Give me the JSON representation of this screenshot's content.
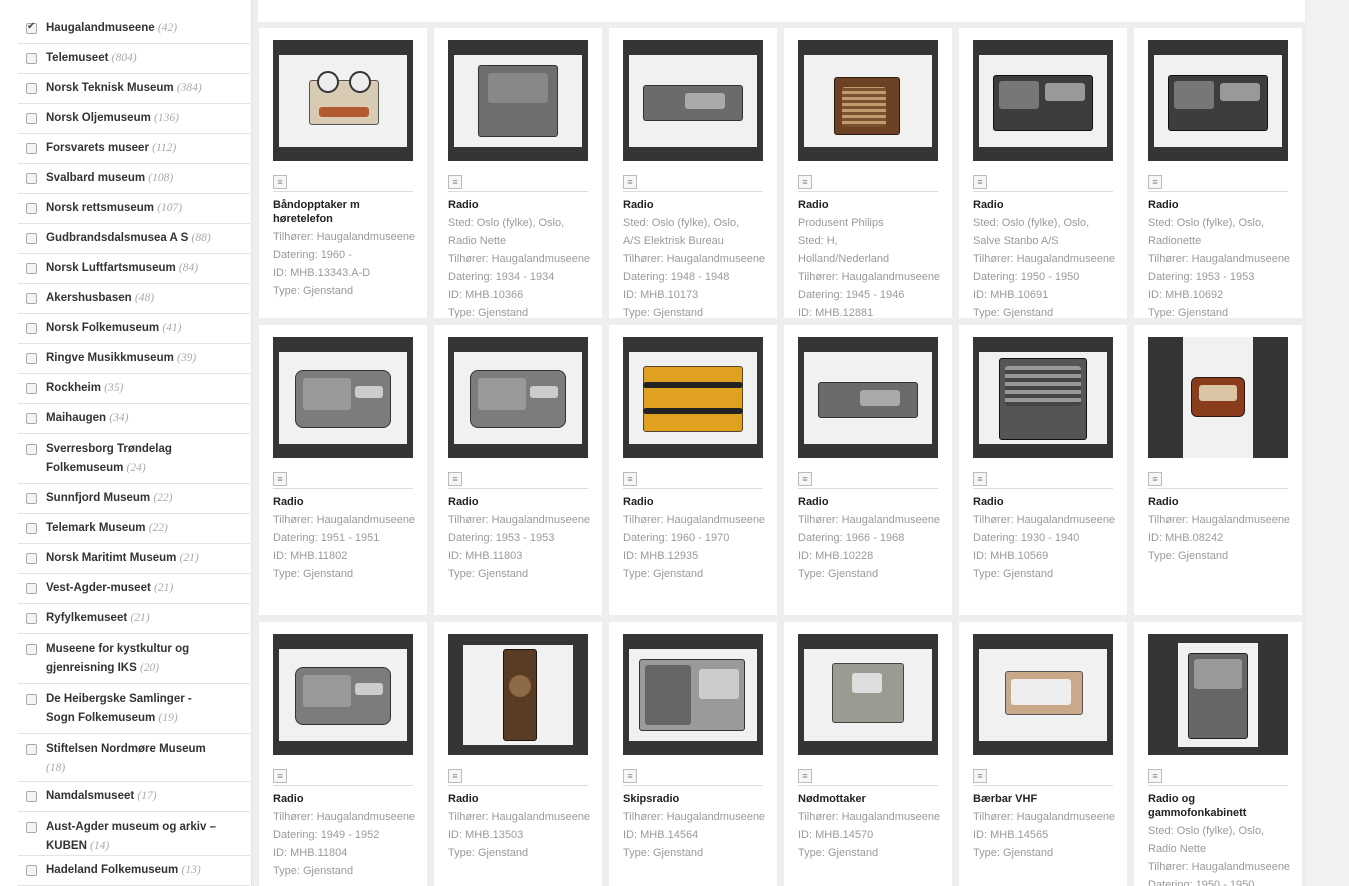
{
  "facets": [
    {
      "label": "Haugalandmuseene",
      "count": "(42)",
      "checked": true
    },
    {
      "label": "Telemuseet",
      "count": "(804)",
      "checked": false
    },
    {
      "label": "Norsk Teknisk Museum",
      "count": "(384)",
      "checked": false
    },
    {
      "label": "Norsk Oljemuseum",
      "count": "(136)",
      "checked": false
    },
    {
      "label": "Forsvarets museer",
      "count": "(112)",
      "checked": false
    },
    {
      "label": "Svalbard museum",
      "count": "(108)",
      "checked": false
    },
    {
      "label": "Norsk rettsmuseum",
      "count": "(107)",
      "checked": false
    },
    {
      "label": "Gudbrandsdalsmusea A S",
      "count": "(88)",
      "checked": false
    },
    {
      "label": "Norsk Luftfartsmuseum",
      "count": "(84)",
      "checked": false
    },
    {
      "label": "Akershusbasen",
      "count": "(48)",
      "checked": false
    },
    {
      "label": "Norsk Folkemuseum",
      "count": "(41)",
      "checked": false
    },
    {
      "label": "Ringve Musikkmuseum",
      "count": "(39)",
      "checked": false
    },
    {
      "label": "Rockheim",
      "count": "(35)",
      "checked": false
    },
    {
      "label": "Maihaugen",
      "count": "(34)",
      "checked": false
    },
    {
      "label": "Sverresborg Trøndelag Folkemuseum",
      "count": "(24)",
      "checked": false
    },
    {
      "label": "Sunnfjord Museum",
      "count": "(22)",
      "checked": false
    },
    {
      "label": "Telemark Museum",
      "count": "(22)",
      "checked": false
    },
    {
      "label": "Norsk Maritimt Museum",
      "count": "(21)",
      "checked": false
    },
    {
      "label": "Vest-Agder-museet",
      "count": "(21)",
      "checked": false
    },
    {
      "label": "Ryfylkemuseet",
      "count": "(21)",
      "checked": false
    },
    {
      "label": "Museene for kystkultur og gjenreisning IKS",
      "count": "(20)",
      "checked": false
    },
    {
      "label": "De Heibergske Samlinger - Sogn Folkemuseum",
      "count": "(19)",
      "checked": false
    },
    {
      "label": "Stiftelsen Nordmøre Museum",
      "count": "(18)",
      "checked": false
    },
    {
      "label": "Namdalsmuseet",
      "count": "(17)",
      "checked": false
    },
    {
      "label": "Aust-Agder museum og arkiv – KUBEN",
      "count": "(14)",
      "checked": false
    },
    {
      "label": "Hadeland Folkemuseum",
      "count": "(13)",
      "checked": false
    }
  ],
  "items": [
    {
      "title": "Båndopptaker m høretelefon",
      "meta": [
        "Tilhører: Haugalandmuseene",
        "Datering: 1960 -",
        "ID: MHB.13343.A-D",
        "Type: Gjenstand"
      ],
      "kind": "tape"
    },
    {
      "title": "Radio",
      "meta": [
        "Sted: Oslo (fylke), Oslo,",
        "Radio Nette",
        "Tilhører: Haugalandmuseene",
        "Datering: 1934 - 1934",
        "ID: MHB.10366",
        "Type: Gjenstand"
      ],
      "kind": "boxradio"
    },
    {
      "title": "Radio",
      "meta": [
        "Sted: Oslo (fylke), Oslo,",
        "A/S Elektrisk Bureau",
        "Tilhører: Haugalandmuseene",
        "Datering: 1948 - 1948",
        "ID: MHB.10173",
        "Type: Gjenstand"
      ],
      "kind": "flatradio"
    },
    {
      "title": "Radio",
      "meta": [
        "Produsent Philips",
        "Sted: H,",
        "Holland/Nederland",
        "Tilhører: Haugalandmuseene",
        "Datering: 1945 - 1946",
        "ID: MHB.12881"
      ],
      "kind": "brownradio"
    },
    {
      "title": "Radio",
      "meta": [
        "Sted: Oslo (fylke), Oslo,",
        "Salve Stanbo A/S",
        "Tilhører: Haugalandmuseene",
        "Datering: 1950 - 1950",
        "ID: MHB.10691",
        "Type: Gjenstand"
      ],
      "kind": "darkradio"
    },
    {
      "title": "Radio",
      "meta": [
        "Sted: Oslo (fylke), Oslo,",
        "Radionette",
        "Tilhører: Haugalandmuseene",
        "Datering: 1953 - 1953",
        "ID: MHB.10692",
        "Type: Gjenstand"
      ],
      "kind": "darkradio"
    },
    {
      "title": "Radio",
      "meta": [
        "Tilhører: Haugalandmuseene",
        "Datering: 1951 - 1951",
        "ID: MHB.11802",
        "Type: Gjenstand"
      ],
      "kind": "greyradio"
    },
    {
      "title": "Radio",
      "meta": [
        "Tilhører: Haugalandmuseene",
        "Datering: 1953 - 1953",
        "ID: MHB.11803",
        "Type: Gjenstand"
      ],
      "kind": "greyradio"
    },
    {
      "title": "Radio",
      "meta": [
        "Tilhører: Haugalandmuseene",
        "Datering: 1960 - 1970",
        "ID: MHB.12935",
        "Type: Gjenstand"
      ],
      "kind": "bag"
    },
    {
      "title": "Radio",
      "meta": [
        "Tilhører: Haugalandmuseene",
        "Datering: 1966 - 1968",
        "ID: MHB.10228",
        "Type: Gjenstand"
      ],
      "kind": "flatradio"
    },
    {
      "title": "Radio",
      "meta": [
        "Tilhører: Haugalandmuseene",
        "Datering: 1930 - 1940",
        "ID: MHB.10569",
        "Type: Gjenstand"
      ],
      "kind": "bigradio"
    },
    {
      "title": "Radio",
      "meta": [
        "Tilhører: Haugalandmuseene",
        "ID: MHB.08242",
        "Type: Gjenstand"
      ],
      "kind": "smallbrown"
    },
    {
      "title": "Radio",
      "meta": [
        "Tilhører: Haugalandmuseene",
        "Datering: 1949 - 1952",
        "ID: MHB.11804",
        "Type: Gjenstand"
      ],
      "kind": "greyradio"
    },
    {
      "title": "Radio",
      "meta": [
        "Tilhører: Haugalandmuseene",
        "ID: MHB.13503",
        "Type: Gjenstand"
      ],
      "kind": "tallbrown"
    },
    {
      "title": "Skipsradio",
      "meta": [
        "Tilhører: Haugalandmuseene",
        "ID: MHB.14564",
        "Type: Gjenstand"
      ],
      "kind": "rack"
    },
    {
      "title": "Nødmottaker",
      "meta": [
        "Tilhører: Haugalandmuseene",
        "ID: MHB.14570",
        "Type: Gjenstand"
      ],
      "kind": "greybox"
    },
    {
      "title": "Bærbar VHF",
      "meta": [
        "Tilhører: Haugalandmuseene",
        "ID: MHB.14565",
        "Type: Gjenstand"
      ],
      "kind": "vhf"
    },
    {
      "title": "Radio og gammofonkabinett",
      "meta": [
        "Sted: Oslo (fylke), Oslo,",
        "Radio Nette",
        "Tilhører: Haugalandmuseene",
        "Datering: 1950 - 1950"
      ],
      "kind": "cabinet"
    }
  ]
}
